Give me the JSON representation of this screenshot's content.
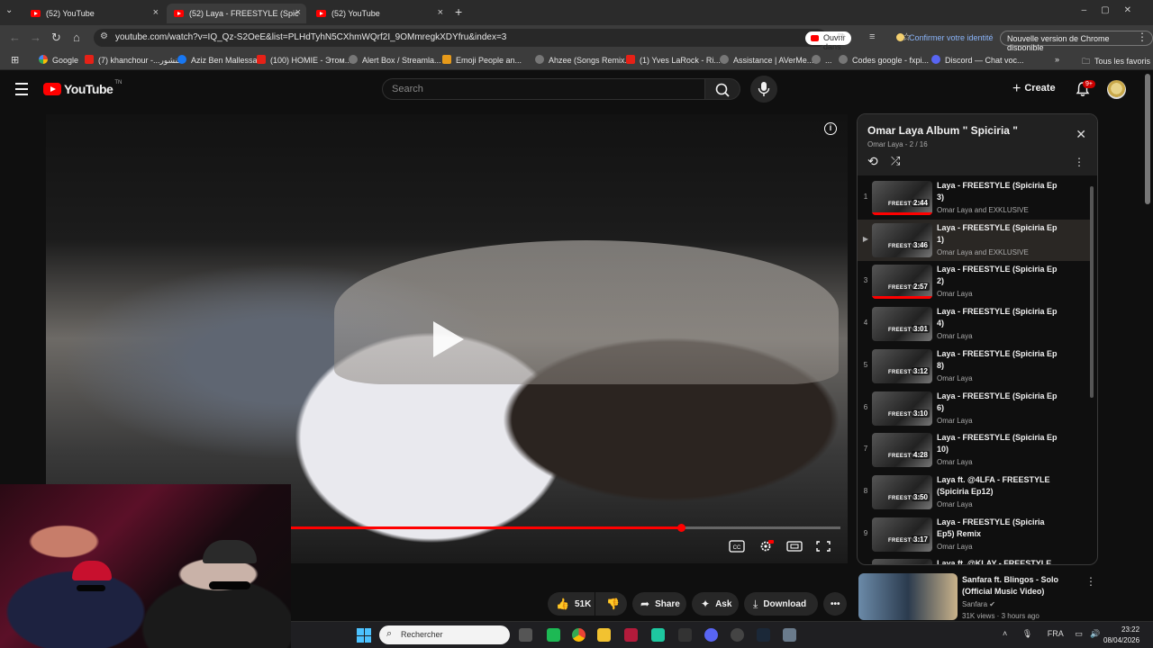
{
  "browser": {
    "tabs": [
      {
        "title": "(52) YouTube",
        "active": false
      },
      {
        "title": "(52) Laya - FREESTYLE (Spic",
        "active": true
      },
      {
        "title": "(52) YouTube",
        "active": false
      }
    ],
    "url": "youtube.com/watch?v=IQ_Qz-S2OeE&list=PLHdTyhN5CXhmWQrf2I_9OMmregkXDYfru&index=3",
    "open_app_label": "Ouvrir dans l'appli",
    "confirm_identity_label": "Confirmer votre identité",
    "new_version_label": "Nouvelle version de Chrome disponible",
    "bookmarks": [
      {
        "label": "Google",
        "icon": "google-icon"
      },
      {
        "label": "(7) khanchour -...خنشور",
        "icon": "youtube-icon"
      },
      {
        "label": "Aziz Ben Mallessa",
        "icon": "facebook-icon"
      },
      {
        "label": "(100) HOMIE - Этом...",
        "icon": "youtube-icon"
      },
      {
        "label": "Alert Box / Streamla...",
        "icon": "globe-icon"
      },
      {
        "label": "Emoji People an...",
        "icon": "emoji-icon"
      },
      {
        "label": "Ahzee (Songs Remix...",
        "icon": "globe-icon"
      },
      {
        "label": "(1) Yves LaRock - Ri...",
        "icon": "youtube-icon"
      },
      {
        "label": "Assistance | AVerMe...",
        "icon": "globe-icon"
      },
      {
        "label": "...",
        "icon": "globe-icon"
      },
      {
        "label": "Codes google - fxpi...",
        "icon": "globe-icon"
      },
      {
        "label": "Discord — Chat voc...",
        "icon": "discord-icon"
      }
    ],
    "all_bookmarks_label": "Tous les favoris"
  },
  "youtube": {
    "logo_text": "YouTube",
    "logo_sup": "TN",
    "search_placeholder": "Search",
    "create_label": "Create",
    "notifications_badge": "9+"
  },
  "player": {
    "progress_fraction": 0.71
  },
  "actions": {
    "like_count": "51K",
    "share_label": "Share",
    "ask_label": "Ask",
    "download_label": "Download"
  },
  "playlist": {
    "title": "Omar Laya Album \" Spiciria \"",
    "subtitle": "Omar Laya - 2 / 16",
    "items": [
      {
        "index": "1",
        "title": "Laya - FREESTYLE (Spiciria Ep 3)",
        "channel": "Omar Laya and EXKLUSIVE",
        "duration": "2:44",
        "tag": "FREESTYLE",
        "watched": 1.0,
        "active": false
      },
      {
        "index": "▶",
        "title": "Laya - FREESTYLE (Spiciria Ep 1)",
        "channel": "Omar Laya and EXKLUSIVE",
        "duration": "3:46",
        "tag": "FREESTYLE",
        "watched": 0.0,
        "active": true
      },
      {
        "index": "3",
        "title": "Laya - FREESTYLE (Spiciria Ep 2)",
        "channel": "Omar Laya",
        "duration": "2:57",
        "tag": "FREESTYLE",
        "watched": 1.0,
        "active": false
      },
      {
        "index": "4",
        "title": "Laya - FREESTYLE (Spiciria Ep 4)",
        "channel": "Omar Laya",
        "duration": "3:01",
        "tag": "FREESTYLE",
        "watched": 0.0,
        "active": false
      },
      {
        "index": "5",
        "title": "Laya - FREESTYLE (Spiciria Ep 8)",
        "channel": "Omar Laya",
        "duration": "3:12",
        "tag": "FREESTYLE",
        "watched": 0.0,
        "active": false
      },
      {
        "index": "6",
        "title": "Laya - FREESTYLE (Spiciria Ep 6)",
        "channel": "Omar Laya",
        "duration": "3:10",
        "tag": "FREESTYLE",
        "watched": 0.0,
        "active": false
      },
      {
        "index": "7",
        "title": "Laya - FREESTYLE (Spiciria Ep 10)",
        "channel": "Omar Laya",
        "duration": "4:28",
        "tag": "FREESTYLE",
        "watched": 0.0,
        "active": false
      },
      {
        "index": "8",
        "title": "Laya ft. @4LFA - FREESTYLE (Spiciria Ep12)",
        "channel": "Omar Laya",
        "duration": "3:50",
        "tag": "FREESTYLE",
        "watched": 0.0,
        "active": false
      },
      {
        "index": "9",
        "title": "Laya - FREESTYLE (Spiciria Ep5) Remix",
        "channel": "Omar Laya",
        "duration": "3:17",
        "tag": "FREESTYLE",
        "watched": 0.0,
        "active": false
      },
      {
        "index": "",
        "title": "Laya ft. @KLAY - FREESTYLE",
        "channel": "",
        "duration": "",
        "tag": "",
        "watched": 0.0,
        "active": false
      }
    ]
  },
  "next_video": {
    "title": "Sanfara ft. Blingos - Solo (Official Music Video)",
    "channel": "Sanfara",
    "meta": "31K views · 3 hours ago"
  },
  "taskbar": {
    "search_placeholder": "Rechercher",
    "language": "FRA",
    "time": "23:22",
    "date": "08/04/2026"
  },
  "colors": {
    "accent_red": "#ff0000",
    "background": "#0f0f0f",
    "link_blue": "#8ab4f8"
  }
}
